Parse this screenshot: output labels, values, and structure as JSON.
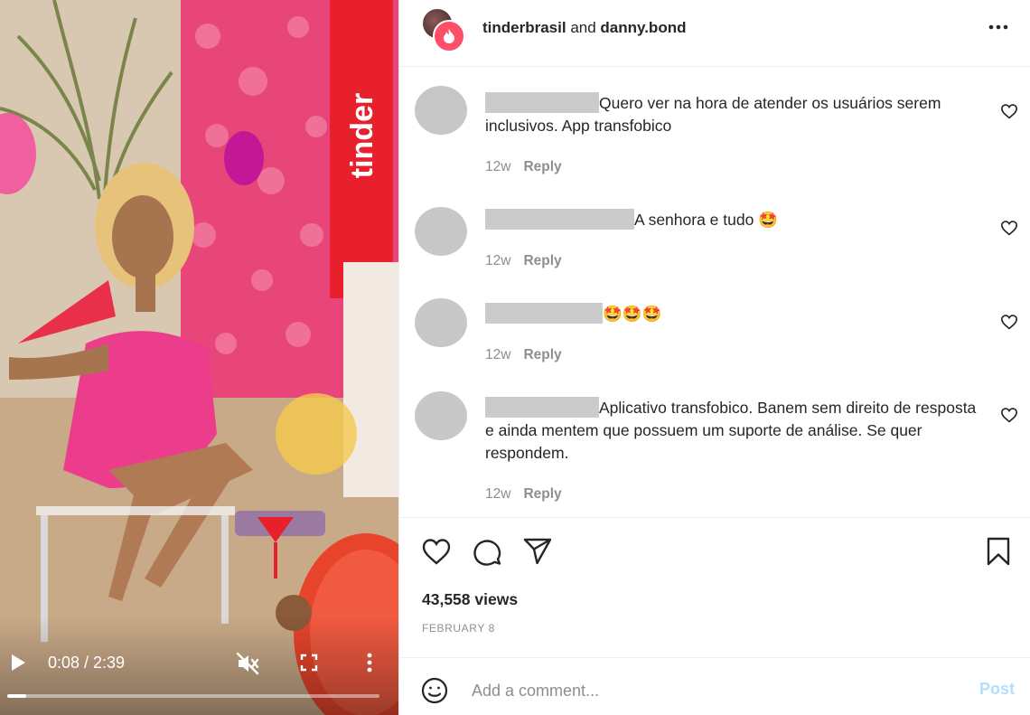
{
  "post": {
    "header": {
      "author": "tinderbrasil",
      "conjunction": " and ",
      "collaborator": "danny.bond"
    },
    "comments": [
      {
        "text": "Quero ver na hora de atender os usuários serem inclusivos. App transfobico",
        "age": "12w",
        "reply_label": "Reply"
      },
      {
        "text": "A senhora e tudo 🤩",
        "age": "12w",
        "reply_label": "Reply"
      },
      {
        "text": "🤩🤩🤩",
        "age": "12w",
        "reply_label": "Reply"
      },
      {
        "text": "Aplicativo transfobico. Banem sem direito de resposta e ainda mentem que possuem um suporte de análise. Se quer respondem.",
        "age": "12w",
        "reply_label": "Reply"
      }
    ],
    "views": "43,558 views",
    "date": "FEBRUARY 8",
    "add_comment": {
      "placeholder": "Add a comment...",
      "post_label": "Post"
    }
  },
  "video": {
    "time": "0:08 / 2:39",
    "progress": 0.05,
    "watermark": "tinder",
    "muted": true
  },
  "colors": {
    "accent": "#0095f6",
    "post_disabled": "#b2dffc",
    "tinder": "#fd5068"
  },
  "icons": [
    "play-icon",
    "mute-icon",
    "fullscreen-icon",
    "more-vertical-icon",
    "more-horizontal-icon",
    "heart-icon",
    "comment-icon",
    "share-icon",
    "bookmark-icon",
    "emoji-icon"
  ]
}
